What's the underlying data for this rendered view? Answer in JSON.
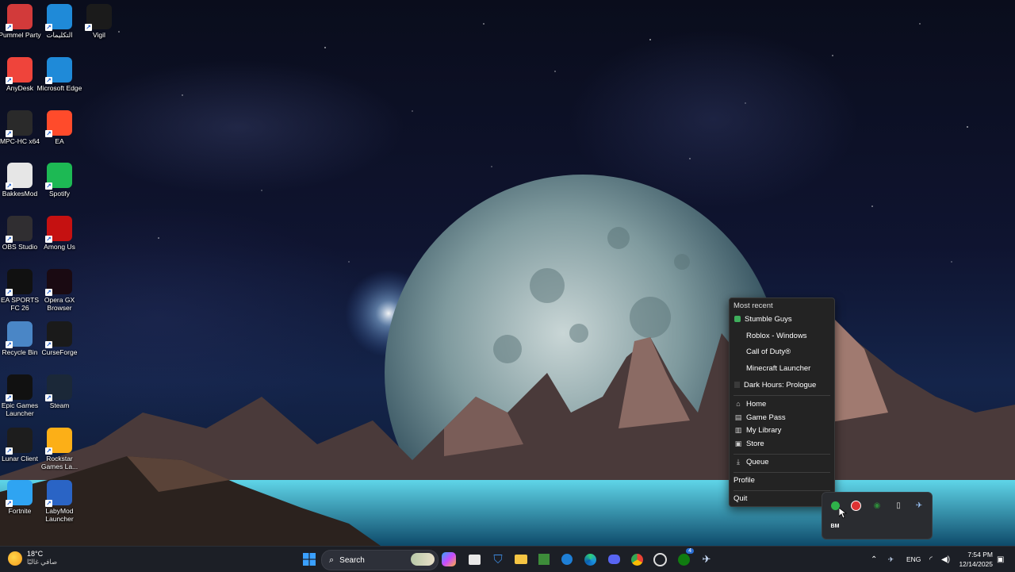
{
  "desktop_icons": [
    {
      "label": "Pummel Party",
      "icon": "pummel-party-icon",
      "color": "#d23a3a"
    },
    {
      "label": "التكليمات",
      "icon": "edge-icon",
      "color": "#1f8ad8"
    },
    {
      "label": "Vigil",
      "icon": "vigil-icon",
      "color": "#1b1b1b"
    },
    {
      "label": "AnyDesk",
      "icon": "anydesk-icon",
      "color": "#ef443b"
    },
    {
      "label": "Microsoft Edge",
      "icon": "edge-icon",
      "color": "#1f8ad8"
    },
    {
      "label": "MPC-HC x64",
      "icon": "mpc-hc-icon",
      "color": "#2a2a2a"
    },
    {
      "label": "EA",
      "icon": "ea-icon",
      "color": "#ff4b2b"
    },
    {
      "label": "BakkesMod",
      "icon": "bakkesmod-icon",
      "color": "#e6e6e6"
    },
    {
      "label": "Spotify",
      "icon": "spotify-icon",
      "color": "#1db954"
    },
    {
      "label": "OBS Studio",
      "icon": "obs-icon",
      "color": "#302e31"
    },
    {
      "label": "Among Us",
      "icon": "among-us-icon",
      "color": "#c51111"
    },
    {
      "label": "EA SPORTS FC 26",
      "icon": "fc26-icon",
      "color": "#111111"
    },
    {
      "label": "Opera GX Browser",
      "icon": "opera-gx-icon",
      "color": "#1a0a12"
    },
    {
      "label": "Recycle Bin",
      "icon": "recycle-bin-icon",
      "color": "#4a86c6"
    },
    {
      "label": "CurseForge",
      "icon": "curseforge-icon",
      "color": "#1a1a1a"
    },
    {
      "label": "Epic Games Launcher",
      "icon": "epic-games-icon",
      "color": "#111111"
    },
    {
      "label": "Steam",
      "icon": "steam-icon",
      "color": "#1b2838"
    },
    {
      "label": "Lunar Client",
      "icon": "lunar-client-icon",
      "color": "#1d1d1d"
    },
    {
      "label": "Rockstar Games La...",
      "icon": "rockstar-icon",
      "color": "#fcaf17"
    },
    {
      "label": "Fortnite",
      "icon": "fortnite-icon",
      "color": "#2fa4f2"
    },
    {
      "label": "LabyMod Launcher",
      "icon": "labymod-icon",
      "color": "#2a64c5"
    }
  ],
  "context_menu": {
    "header": "Most recent",
    "recent": [
      {
        "label": "Stumble Guys",
        "icon": "stumble-guys-icon"
      },
      {
        "label": "Roblox - Windows",
        "icon": ""
      },
      {
        "label": "Call of Duty®",
        "icon": ""
      },
      {
        "label": "Minecraft Launcher",
        "icon": ""
      },
      {
        "label": "Dark Hours: Prologue",
        "icon": "dark-hours-icon"
      }
    ],
    "nav": [
      {
        "label": "Home",
        "icon": "home-icon"
      },
      {
        "label": "Game Pass",
        "icon": "game-pass-icon"
      },
      {
        "label": "My Library",
        "icon": "library-icon"
      },
      {
        "label": "Store",
        "icon": "store-icon"
      }
    ],
    "queue": {
      "label": "Queue",
      "icon": "download-icon"
    },
    "profile": "Profile",
    "quit": "Quit"
  },
  "tray_flyout": {
    "icons": [
      "xbox-icon",
      "rockstar-tray-icon",
      "razer-icon",
      "usb-icon",
      "steam-tray-icon"
    ],
    "bakkesmod_label": "BM"
  },
  "taskbar": {
    "weather": {
      "temp": "18°C",
      "condition": "صافي غالبًا"
    },
    "search_placeholder": "Search",
    "apps": [
      "copilot-icon",
      "microsoft-store-icon",
      "defender-icon",
      "file-explorer-icon",
      "minecraft-icon",
      "edge-beta-icon",
      "edge-icon",
      "discord-icon",
      "chrome-icon",
      "steelseries-icon",
      "xbox-app-icon",
      "steam-icon"
    ],
    "xbox_badge": "4",
    "language": "ENG",
    "time": "7:54 PM",
    "date": "12/14/2025"
  },
  "colors": {
    "taskbar_bg": "#1c1f26",
    "menu_bg": "#232323",
    "accent": "#2b6fd6"
  }
}
